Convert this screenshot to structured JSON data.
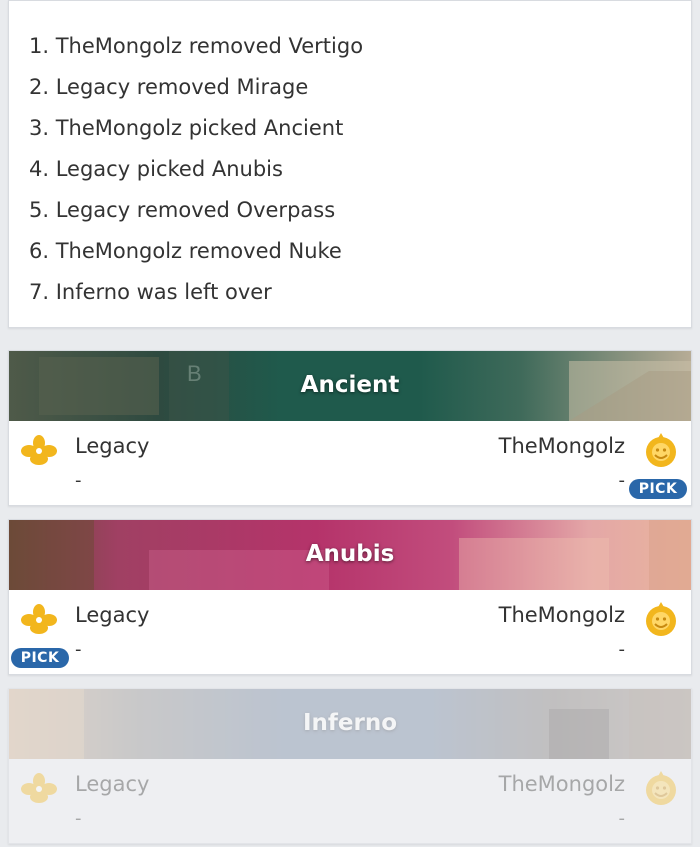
{
  "veto": {
    "steps": [
      "1. TheMongolz removed Vertigo",
      "2. Legacy removed Mirage",
      "3. TheMongolz picked Ancient",
      "4. Legacy picked Anubis",
      "5. Legacy removed Overpass",
      "6. TheMongolz removed Nuke",
      "7. Inferno was left over"
    ]
  },
  "maps": [
    {
      "name": "Ancient",
      "banner_color": "#1f5a4c",
      "team1": {
        "name": "Legacy",
        "score": "-",
        "logo_icon": "legacy-logo-icon"
      },
      "team2": {
        "name": "TheMongolz",
        "score": "-",
        "logo_icon": "themongolz-logo-icon"
      },
      "pick_label": "PICK",
      "picked_by": "team2",
      "state": "played"
    },
    {
      "name": "Anubis",
      "banner_color": "#b5336a",
      "team1": {
        "name": "Legacy",
        "score": "-",
        "logo_icon": "legacy-logo-icon"
      },
      "team2": {
        "name": "TheMongolz",
        "score": "-",
        "logo_icon": "themongolz-logo-icon"
      },
      "pick_label": "PICK",
      "picked_by": "team1",
      "state": "played"
    },
    {
      "name": "Inferno",
      "banner_color": "#6b7f9a",
      "team1": {
        "name": "Legacy",
        "score": "-",
        "logo_icon": "legacy-logo-icon"
      },
      "team2": {
        "name": "TheMongolz",
        "score": "-",
        "logo_icon": "themongolz-logo-icon"
      },
      "picked_by": "none",
      "state": "leftover"
    }
  ],
  "colors": {
    "pick_badge": "#2a67a9",
    "logo_gold": "#f2b61d",
    "page_background": "#e9ebee"
  }
}
